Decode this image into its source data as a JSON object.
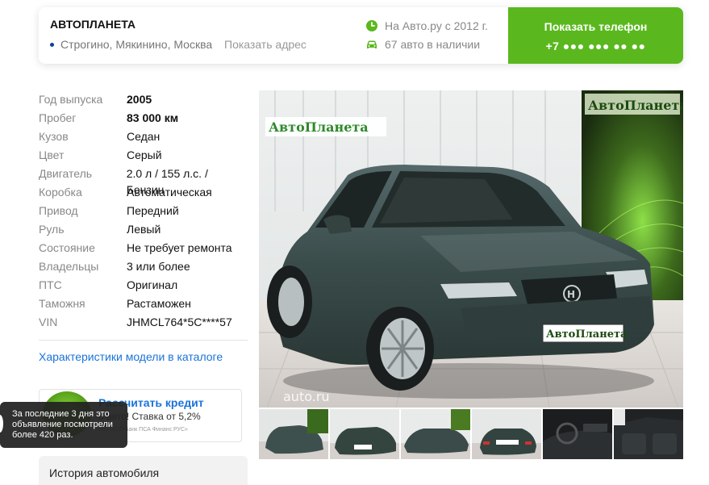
{
  "dealer": {
    "name": "АВТОПЛАНЕТА",
    "location": "Строгино, Мякинино, Москва",
    "show_address": "Показать адрес",
    "since": "На Авто.ру с 2012 г.",
    "cars_count": "67 авто в наличии",
    "phone_label": "Показать телефон",
    "phone_masked": "+7 ●●● ●●● ●● ●●"
  },
  "specs": [
    {
      "label": "Год выпуска",
      "value": "2005"
    },
    {
      "label": "Пробег",
      "value": "83 000 км"
    },
    {
      "label": "Кузов",
      "value": "Седан"
    },
    {
      "label": "Цвет",
      "value": "Серый"
    },
    {
      "label": "Двигатель",
      "value": "2.0 л / 155 л.с. / Бензин"
    },
    {
      "label": "Коробка",
      "value": "Автоматическая"
    },
    {
      "label": "Привод",
      "value": "Передний"
    },
    {
      "label": "Руль",
      "value": "Левый"
    },
    {
      "label": "Состояние",
      "value": "Не требует ремонта"
    },
    {
      "label": "Владельцы",
      "value": "3 или более"
    },
    {
      "label": "ПТС",
      "value": "Оригинал"
    },
    {
      "label": "Таможня",
      "value": "Растаможен"
    },
    {
      "label": "VIN",
      "value": "JHMCL764*5C****57"
    }
  ],
  "catalog_link": "Характеристики модели в каталоге",
  "credit": {
    "title": "Рассчитать кредит",
    "subtitle": "о авто! Ставка от 5,2%",
    "note": "мер ООО Банк ПСА Финанс РУС»"
  },
  "toast": {
    "line1": "За последние 3 дня это",
    "line2": "объявление посмотрели",
    "line3": "более 420 раз."
  },
  "history": "История автомобиля",
  "photo": {
    "watermark": "auto.ru",
    "sign": "АвтоПланета",
    "plate": "АвтоПланета"
  },
  "colors": {
    "accent_green": "#5ab81e",
    "link_blue": "#1a73d9",
    "car_body": "#3a4c4a"
  },
  "icons": {
    "since": "clock-icon",
    "cars": "car-icon",
    "metro": "metro-dot-icon"
  }
}
